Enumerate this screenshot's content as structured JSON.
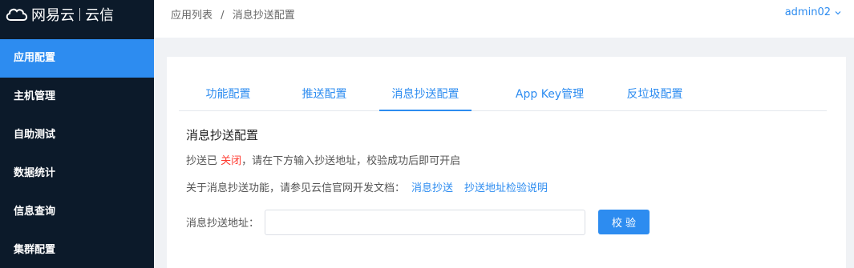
{
  "brand": {
    "name": "网易云",
    "product": "云信"
  },
  "sidebar": {
    "items": [
      {
        "label": "应用配置",
        "active": true
      },
      {
        "label": "主机管理"
      },
      {
        "label": "自助测试"
      },
      {
        "label": "数据统计"
      },
      {
        "label": "信息查询"
      },
      {
        "label": "集群配置"
      }
    ]
  },
  "header": {
    "breadcrumb": [
      "应用列表",
      "消息抄送配置"
    ],
    "separator": "/",
    "user": "admin02"
  },
  "tabs": [
    {
      "label": "功能配置"
    },
    {
      "label": "推送配置"
    },
    {
      "label": "消息抄送配置",
      "active": true
    },
    {
      "label": "App Key管理"
    },
    {
      "label": "反垃圾配置"
    }
  ],
  "main": {
    "title": "消息抄送配置",
    "status_prefix": "抄送已 ",
    "status_value": "关闭",
    "status_suffix": "，请在下方输入抄送地址，校验成功后即可开启",
    "doc_text": "关于消息抄送功能，请参见云信官网开发文档：",
    "doc_links": [
      "消息抄送",
      "抄送地址检验说明"
    ],
    "address_label": "消息抄送地址：",
    "address_value": "",
    "verify_label": "校 验"
  },
  "colors": {
    "accent": "#2d8cf0",
    "sidebar_bg": "#0c1a2a",
    "status_off": "#ff3b30"
  }
}
